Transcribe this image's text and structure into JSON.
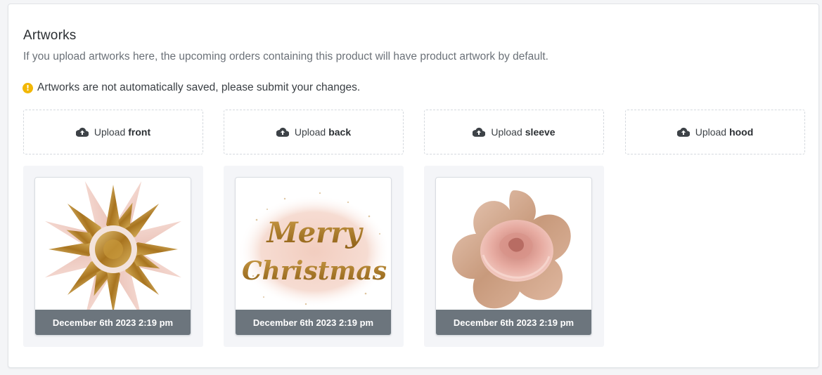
{
  "section": {
    "title": "Artworks",
    "subtitle": "If you upload artworks here, the upcoming orders containing this product will have product artwork by default.",
    "warning": "Artworks are not automatically saved, please submit your changes.",
    "warning_icon": "exclamation-circle-icon"
  },
  "uploads": [
    {
      "prefix": "Upload",
      "part": "front",
      "icon": "cloud-upload-icon"
    },
    {
      "prefix": "Upload",
      "part": "back",
      "icon": "cloud-upload-icon"
    },
    {
      "prefix": "Upload",
      "part": "sleeve",
      "icon": "cloud-upload-icon"
    },
    {
      "prefix": "Upload",
      "part": "hood",
      "icon": "cloud-upload-icon"
    }
  ],
  "artworks": [
    {
      "caption": "December 6th 2023 2:19 pm",
      "image": "gold-glitter-starburst"
    },
    {
      "caption": "December 6th 2023 2:19 pm",
      "image": "merry-christmas-lettering",
      "text_line1": "Merry",
      "text_line2": "Christmas"
    },
    {
      "caption": "December 6th 2023 2:19 pm",
      "image": "rose-gold-glitter-rose"
    }
  ],
  "colors": {
    "warning": "#f2b705",
    "caption_bg": "#6c757d",
    "gold": "#b8862e",
    "rose": "#e8b9ae"
  }
}
